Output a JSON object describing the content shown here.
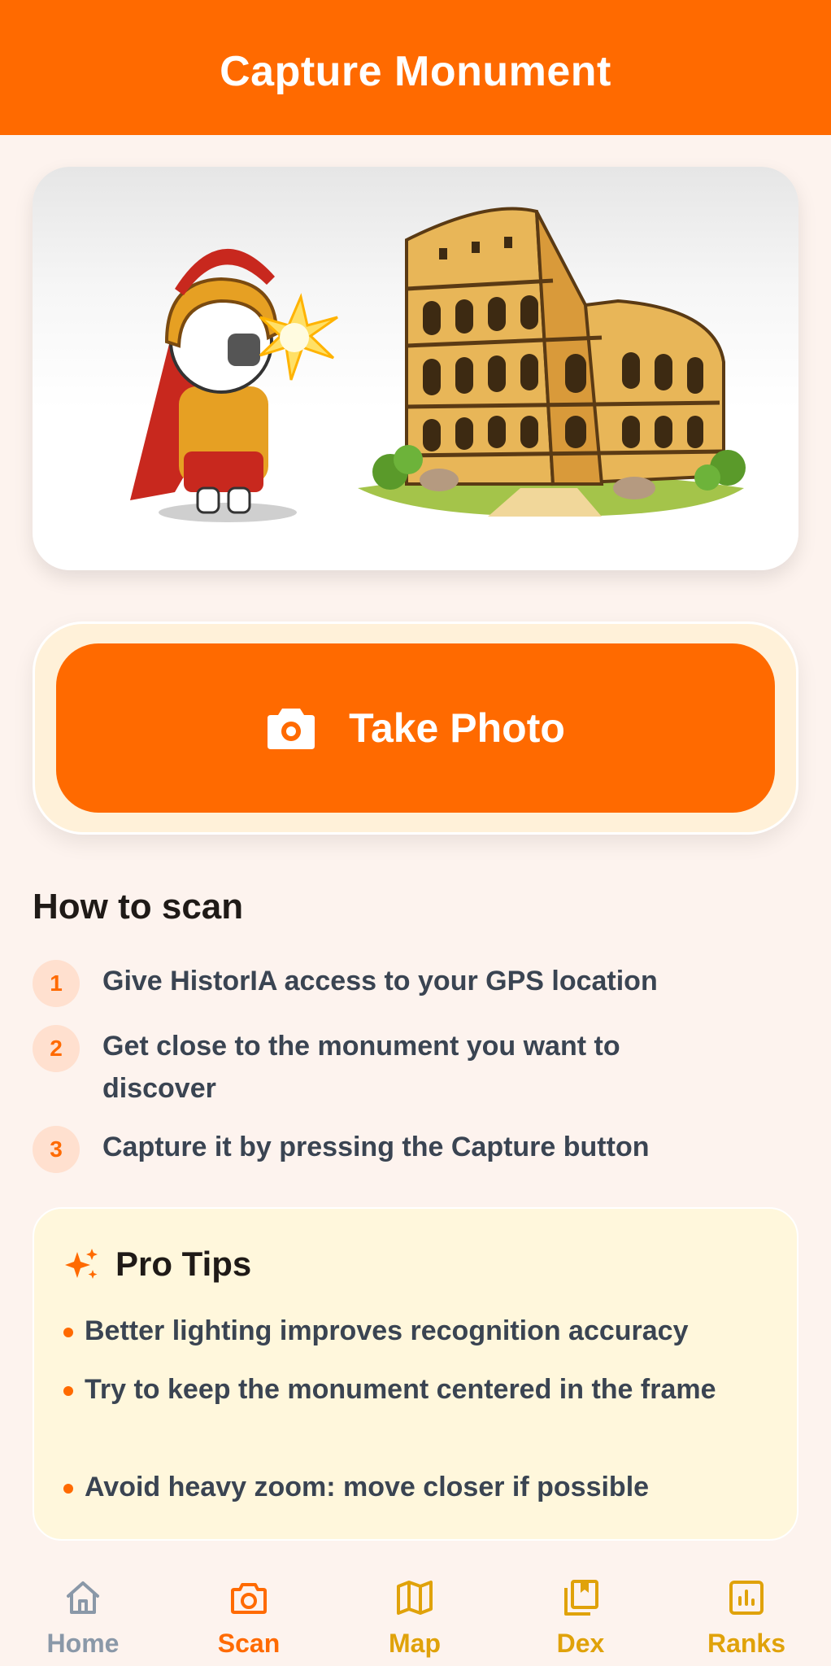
{
  "header": {
    "title": "Capture Monument"
  },
  "action": {
    "take_photo_label": "Take Photo"
  },
  "how_to": {
    "title": "How to scan",
    "steps": [
      {
        "num": "1",
        "text": "Give HistorIA access to your GPS location"
      },
      {
        "num": "2",
        "text": "Get close to the monument you want to discover"
      },
      {
        "num": "3",
        "text": "Capture it by pressing the Capture button"
      }
    ]
  },
  "tips": {
    "title": "Pro Tips",
    "items": [
      "Better lighting improves recognition accuracy",
      "Try to keep the monument centered in the frame",
      "Avoid heavy zoom: move closer if possible"
    ]
  },
  "nav": {
    "items": [
      {
        "label": "Home",
        "icon": "home-icon",
        "color": "#8a98a8"
      },
      {
        "label": "Scan",
        "icon": "camera-icon",
        "color": "#ff6a00"
      },
      {
        "label": "Map",
        "icon": "map-icon",
        "color": "#e0a20a"
      },
      {
        "label": "Dex",
        "icon": "book-icon",
        "color": "#e0a20a"
      },
      {
        "label": "Ranks",
        "icon": "chart-icon",
        "color": "#e0a20a"
      }
    ]
  },
  "colors": {
    "accent": "#ff6a00",
    "background": "#fdf3ee",
    "tips_bg": "#fff7dc"
  }
}
